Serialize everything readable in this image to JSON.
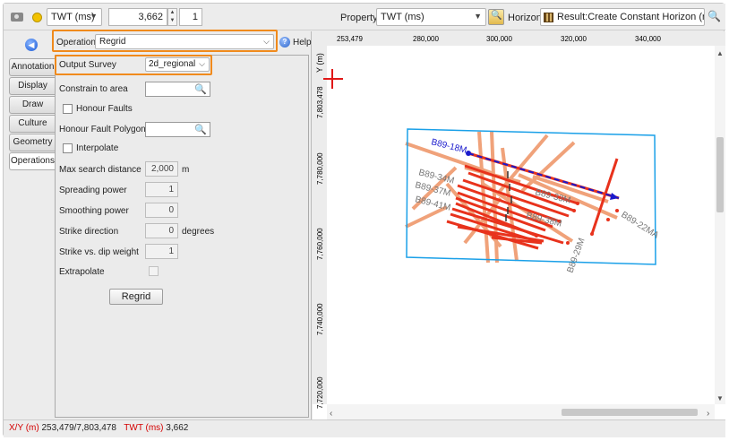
{
  "toolbar": {
    "domain_select": "TWT (ms)",
    "value": "3,662",
    "step": "1",
    "property_label": "Property",
    "property_select": "TWT (ms)",
    "horizon_label": "Horizon",
    "horizon_value": "Result:Create Constant Horizon (regrid)"
  },
  "tabs": [
    "Annotation",
    "Display",
    "Draw",
    "Culture",
    "Geometry",
    "Operations"
  ],
  "active_tab": "Operations",
  "form": {
    "operation_label": "Operation",
    "operation_value": "Regrid",
    "help_label": "Help",
    "output_survey_label": "Output Survey",
    "output_survey_value": "2d_regional",
    "constrain_label": "Constrain to area",
    "honour_faults_label": "Honour Faults",
    "honour_fault_polygons_label": "Honour Fault Polygons",
    "interpolate_label": "Interpolate",
    "max_search_label": "Max search distance",
    "max_search_value": "2,000",
    "max_search_unit": "m",
    "spreading_label": "Spreading power",
    "spreading_value": "1",
    "smoothing_label": "Smoothing power",
    "smoothing_value": "0",
    "strike_label": "Strike direction",
    "strike_value": "0",
    "strike_unit": "degrees",
    "strike_dip_label": "Strike vs. dip weight",
    "strike_dip_value": "1",
    "extrapolate_label": "Extrapolate",
    "regrid_button": "Regrid"
  },
  "map": {
    "x_ticks": [
      "253,479",
      "280,000",
      "300,000",
      "320,000",
      "340,000"
    ],
    "y_axis_label": "Y (m)",
    "y_ticks": [
      "7,803,478",
      "7,780,000",
      "7,760,000",
      "7,740,000",
      "7,720,000"
    ],
    "lines": {
      "selected": "B89-18M",
      "other": [
        "B89-34M",
        "B89-37M",
        "B89-41M",
        "B89-33M",
        "B89-38M",
        "B89-22MA",
        "B89-29M"
      ]
    }
  },
  "status": {
    "xy_label": "X/Y (m)",
    "xy_value": "253,479/7,803,478",
    "twt_label": "TWT (ms)",
    "twt_value": "3,662"
  },
  "colors": {
    "highlight": "#f08a1c",
    "line_red": "#e8321c",
    "line_orange": "#f0a27a",
    "selected_line": "#1a1acc",
    "boundary": "#1aa0e8"
  }
}
